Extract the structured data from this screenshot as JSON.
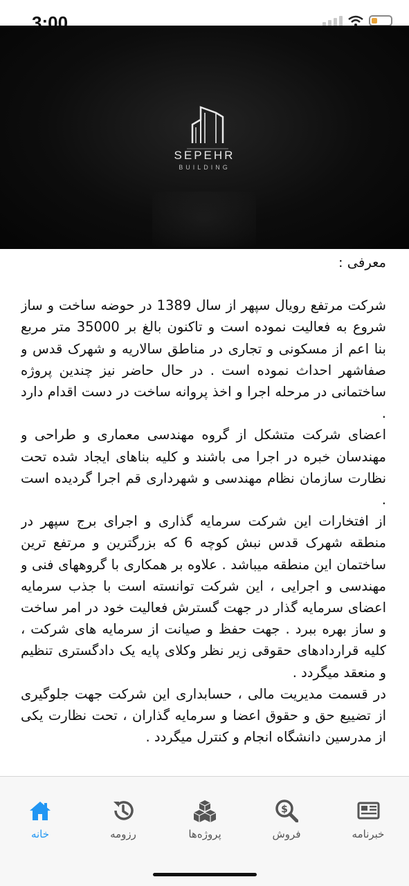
{
  "status_bar": {
    "time": "3:00"
  },
  "hero": {
    "logo_name": "SEPEHR",
    "logo_sub": "BUILDING"
  },
  "content": {
    "title": "معرفی :",
    "paragraphs": [
      " شرکت مرتفع رویال سپهر از سال 1389 در حوضه ساخت و ساز شروع به فعالیت نموده است و تاکنون بالغ بر 35000 متر مربع بنا اعم از مسکونی و تجاری در مناطق سالاریه و شهرک قدس و صفاشهر احداث نموده است . در حال حاضر نیز چندین پروژه ساختمانی در مرحله اجرا و اخذ پروانه ساخت در دست اقدام دارد .",
      "اعضای شرکت متشکل از گروه مهندسی معماری و طراحی و مهندسان خبره در اجرا می باشند و کلیه بناهای ایجاد شده تحت نظارت سازمان نظام مهندسی و شهرداری قم اجرا گردیده است .",
      "از افتخارات این شرکت سرمایه گذاری و اجرای برج سپهر در منطقه شهرک قدس نبش کوچه 6 که بزرگترین و مرتفع ترین ساختمان این منطقه میباشد . علاوه بر همکاری با گروههای فنی و مهندسی و اجرایی ، این شرکت توانسته است با جذب سرمایه اعضای سرمایه گذار در جهت گسترش فعالیت خود در امر ساخت و ساز بهره ببرد . جهت حفظ و صیانت از سرمایه های شرکت ، کلیه قراردادهای حقوقی زیر نظر وکلای پایه یک دادگستری تنظیم و منعقد میگردد .",
      "در قسمت مدیریت مالی ، حسابداری این شرکت جهت جلوگیری از تضییع حق و حقوق اعضا و سرمایه گذاران ، تحت نظارت یکی از مدرسین دانشگاه انجام و کنترل میگردد ."
    ]
  },
  "bottom_nav": {
    "accent_color": "#2196f3",
    "inactive_color": "#555555",
    "items": [
      {
        "label": "خانه",
        "icon": "home-icon",
        "active": true
      },
      {
        "label": "رزومه",
        "icon": "history-icon",
        "active": false
      },
      {
        "label": "پروژه‌ها",
        "icon": "cubes-icon",
        "active": false
      },
      {
        "label": "فروش",
        "icon": "search-dollar-icon",
        "active": false
      },
      {
        "label": "خبرنامه",
        "icon": "newspaper-icon",
        "active": false
      }
    ]
  }
}
